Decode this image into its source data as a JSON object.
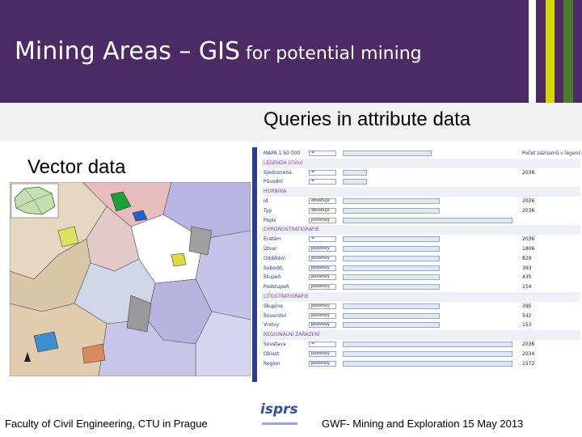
{
  "slide": {
    "title_main": "Mining Areas – GIS",
    "title_rest": " for potential mining",
    "subtitle_right": "Queries in attribute data",
    "subtitle_left": "Vector data",
    "footer_left": "Faculty of Civil Engineering, CTU in Prague",
    "footer_right": "GWF- Mining and Exploration 15 May 2013",
    "logo_text": "isprs"
  },
  "colors": {
    "header_bg": "#4b2a66",
    "stripe_white": "#ffffff",
    "stripe_yellow": "#d6d600",
    "stripe_green": "#4b7a2a",
    "panel_border": "#2a3d8f",
    "section_text": "#8a4cb0"
  },
  "icons": [
    "isprs-logo",
    "north-arrow-icon"
  ]
}
